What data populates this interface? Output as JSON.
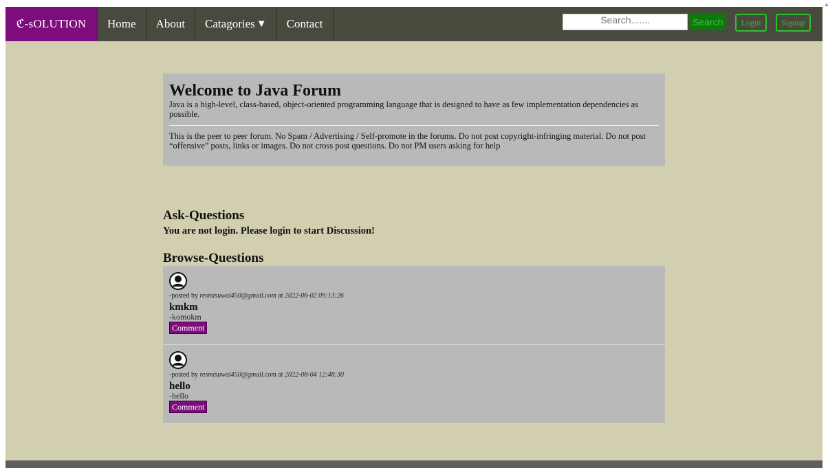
{
  "navbar": {
    "brand": "ℭ-sOLUTION",
    "items": [
      {
        "label": "Home"
      },
      {
        "label": "About"
      },
      {
        "label": "Catagories"
      },
      {
        "label": "Contact"
      }
    ],
    "categories_caret": "▼",
    "search_placeholder": "Search.......",
    "search_button": "Search",
    "login_button": "Login",
    "signup_button": "Signup"
  },
  "jumbotron": {
    "title": "Welcome to Java Forum",
    "description": "Java is a high-level, class-based, object-oriented programming language that is designed to have as few implementation dependencies as possible.",
    "rules": "This is the peer to peer forum. No Spam / Advertising / Self-promote in the forums. Do not post copyright-infringing material. Do not post “offensive” posts, links or images. Do not cross post questions. Do not PM users asking for help"
  },
  "ask": {
    "heading": "Ask-Questions",
    "note": "You are not login. Please login to start Discussion!"
  },
  "browse": {
    "heading": "Browse-Questions",
    "posted_by_prefix": "-posted by",
    "at_word": "at",
    "questions": [
      {
        "author": "resmisuwal450@gmail.com",
        "timestamp": "2022-06-02 09:13:26",
        "title": "kmkm",
        "body": "-komokm",
        "comment_label": "Comment"
      },
      {
        "author": "resmisuwal450@gmail.com",
        "timestamp": "2022-08-04 12:48:30",
        "title": "hello",
        "body": "-hello",
        "comment_label": "Comment"
      }
    ]
  },
  "colors": {
    "page_bg": "#d2cfb0",
    "navbar_bg": "#494a3e",
    "brand_bg": "#7d0d7d",
    "accent_green": "#2ec12e",
    "card_bg": "#bab9b9"
  },
  "icons": {
    "avatar": "user-avatar-icon",
    "dropdown": "caret-down-icon"
  }
}
